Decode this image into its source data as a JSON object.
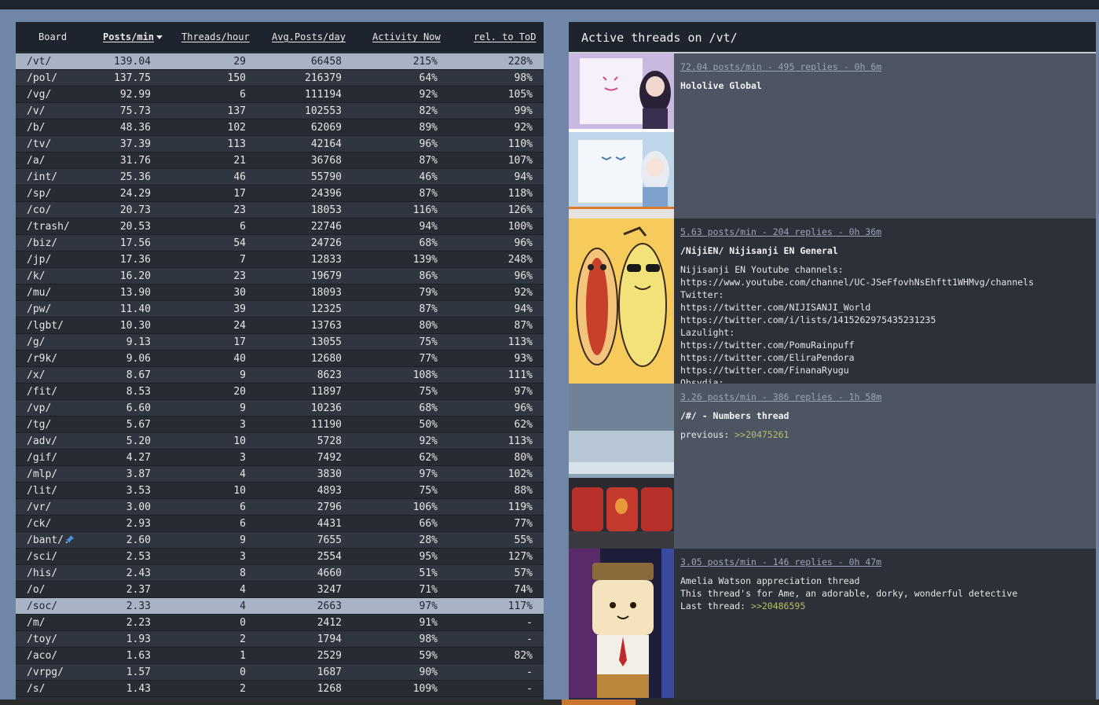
{
  "table": {
    "headers": {
      "board": "Board",
      "posts_per_min": "Posts/min",
      "threads_per_hour": "Threads/hour",
      "avg_posts_day": "Avg.Posts/day",
      "activity_now": "Activity Now",
      "rel_tod": "rel. to ToD"
    },
    "rows": [
      {
        "board": "/vt/",
        "ppm": "139.04",
        "tph": "29",
        "apd": "66458",
        "act": "215%",
        "rel": "228%",
        "highlight": true
      },
      {
        "board": "/pol/",
        "ppm": "137.75",
        "tph": "150",
        "apd": "216379",
        "act": "64%",
        "rel": "98%"
      },
      {
        "board": "/vg/",
        "ppm": "92.99",
        "tph": "6",
        "apd": "111194",
        "act": "92%",
        "rel": "105%"
      },
      {
        "board": "/v/",
        "ppm": "75.73",
        "tph": "137",
        "apd": "102553",
        "act": "82%",
        "rel": "99%"
      },
      {
        "board": "/b/",
        "ppm": "48.36",
        "tph": "102",
        "apd": "62069",
        "act": "89%",
        "rel": "92%"
      },
      {
        "board": "/tv/",
        "ppm": "37.39",
        "tph": "113",
        "apd": "42164",
        "act": "96%",
        "rel": "110%"
      },
      {
        "board": "/a/",
        "ppm": "31.76",
        "tph": "21",
        "apd": "36768",
        "act": "87%",
        "rel": "107%"
      },
      {
        "board": "/int/",
        "ppm": "25.36",
        "tph": "46",
        "apd": "55790",
        "act": "46%",
        "rel": "94%"
      },
      {
        "board": "/sp/",
        "ppm": "24.29",
        "tph": "17",
        "apd": "24396",
        "act": "87%",
        "rel": "118%"
      },
      {
        "board": "/co/",
        "ppm": "20.73",
        "tph": "23",
        "apd": "18053",
        "act": "116%",
        "rel": "126%"
      },
      {
        "board": "/trash/",
        "ppm": "20.53",
        "tph": "6",
        "apd": "22746",
        "act": "94%",
        "rel": "100%"
      },
      {
        "board": "/biz/",
        "ppm": "17.56",
        "tph": "54",
        "apd": "24726",
        "act": "68%",
        "rel": "96%"
      },
      {
        "board": "/jp/",
        "ppm": "17.36",
        "tph": "7",
        "apd": "12833",
        "act": "139%",
        "rel": "248%"
      },
      {
        "board": "/k/",
        "ppm": "16.20",
        "tph": "23",
        "apd": "19679",
        "act": "86%",
        "rel": "96%"
      },
      {
        "board": "/mu/",
        "ppm": "13.90",
        "tph": "30",
        "apd": "18093",
        "act": "79%",
        "rel": "92%"
      },
      {
        "board": "/pw/",
        "ppm": "11.40",
        "tph": "39",
        "apd": "12325",
        "act": "87%",
        "rel": "94%"
      },
      {
        "board": "/lgbt/",
        "ppm": "10.30",
        "tph": "24",
        "apd": "13763",
        "act": "80%",
        "rel": "87%"
      },
      {
        "board": "/g/",
        "ppm": "9.13",
        "tph": "17",
        "apd": "13055",
        "act": "75%",
        "rel": "113%"
      },
      {
        "board": "/r9k/",
        "ppm": "9.06",
        "tph": "40",
        "apd": "12680",
        "act": "77%",
        "rel": "93%"
      },
      {
        "board": "/x/",
        "ppm": "8.67",
        "tph": "9",
        "apd": "8623",
        "act": "108%",
        "rel": "111%"
      },
      {
        "board": "/fit/",
        "ppm": "8.53",
        "tph": "20",
        "apd": "11897",
        "act": "75%",
        "rel": "97%"
      },
      {
        "board": "/vp/",
        "ppm": "6.60",
        "tph": "9",
        "apd": "10236",
        "act": "68%",
        "rel": "96%"
      },
      {
        "board": "/tg/",
        "ppm": "5.67",
        "tph": "3",
        "apd": "11190",
        "act": "50%",
        "rel": "62%"
      },
      {
        "board": "/adv/",
        "ppm": "5.20",
        "tph": "10",
        "apd": "5728",
        "act": "92%",
        "rel": "113%"
      },
      {
        "board": "/gif/",
        "ppm": "4.27",
        "tph": "3",
        "apd": "7492",
        "act": "62%",
        "rel": "80%"
      },
      {
        "board": "/mlp/",
        "ppm": "3.87",
        "tph": "4",
        "apd": "3830",
        "act": "97%",
        "rel": "102%"
      },
      {
        "board": "/lit/",
        "ppm": "3.53",
        "tph": "10",
        "apd": "4893",
        "act": "75%",
        "rel": "88%"
      },
      {
        "board": "/vr/",
        "ppm": "3.00",
        "tph": "6",
        "apd": "2796",
        "act": "106%",
        "rel": "119%"
      },
      {
        "board": "/ck/",
        "ppm": "2.93",
        "tph": "6",
        "apd": "4431",
        "act": "66%",
        "rel": "77%"
      },
      {
        "board": "/bant/",
        "ppm": "2.60",
        "tph": "9",
        "apd": "7655",
        "act": "28%",
        "rel": "55%",
        "pinned": true
      },
      {
        "board": "/sci/",
        "ppm": "2.53",
        "tph": "3",
        "apd": "2554",
        "act": "95%",
        "rel": "127%"
      },
      {
        "board": "/his/",
        "ppm": "2.43",
        "tph": "8",
        "apd": "4660",
        "act": "51%",
        "rel": "57%"
      },
      {
        "board": "/o/",
        "ppm": "2.37",
        "tph": "4",
        "apd": "3247",
        "act": "71%",
        "rel": "74%"
      },
      {
        "board": "/soc/",
        "ppm": "2.33",
        "tph": "4",
        "apd": "2663",
        "act": "97%",
        "rel": "117%",
        "highlight": true
      },
      {
        "board": "/m/",
        "ppm": "2.23",
        "tph": "0",
        "apd": "2412",
        "act": "91%",
        "rel": "-"
      },
      {
        "board": "/toy/",
        "ppm": "1.93",
        "tph": "2",
        "apd": "1794",
        "act": "98%",
        "rel": "-"
      },
      {
        "board": "/aco/",
        "ppm": "1.63",
        "tph": "1",
        "apd": "2529",
        "act": "59%",
        "rel": "82%"
      },
      {
        "board": "/vrpg/",
        "ppm": "1.57",
        "tph": "0",
        "apd": "1687",
        "act": "90%",
        "rel": "-"
      },
      {
        "board": "/s/",
        "ppm": "1.43",
        "tph": "2",
        "apd": "1268",
        "act": "109%",
        "rel": "-"
      }
    ]
  },
  "panel": {
    "title": "Active threads on /vt/",
    "threads": [
      {
        "meta": "72.04 posts/min - 495 replies - 0h 6m",
        "title": "Hololive Global",
        "lines": []
      },
      {
        "meta": "5.63 posts/min - 204 replies - 0h 36m",
        "title": "/NijiEN/ Nijisanji EN General",
        "lines": [
          "Nijisanji EN Youtube channels:",
          "https://www.youtube.com/channel/UC-JSeFfovhNsEhftt1WHMvg/channels",
          "Twitter:",
          "https://twitter.com/NIJISANJI_World",
          "https://twitter.com/i/lists/1415262975435231235",
          "Lazulight:",
          "https://twitter.com/PomuRainpuff",
          "https://twitter.com/EliraPendora",
          "https://twitter.com/FinanaRyugu",
          "Obsydia:"
        ]
      },
      {
        "meta": "3.26 posts/min - 386 replies - 1h 58m",
        "title": "/#/ - Numbers thread",
        "lines_prefix": "previous: ",
        "quote": ">>20475261"
      },
      {
        "meta": "3.05 posts/min - 146 replies - 0h 47m",
        "title": "Amelia Watson appreciation thread",
        "lines": [
          "This thread's for Ame, an adorable, dorky, wonderful detective"
        ],
        "last_prefix": "Last thread: ",
        "quote": ">>20486595"
      }
    ]
  }
}
